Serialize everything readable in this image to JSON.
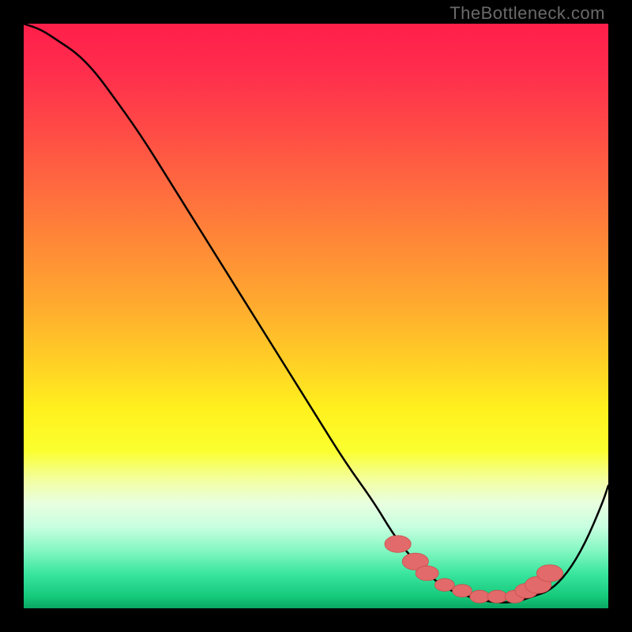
{
  "watermark": "TheBottleneck.com",
  "colors": {
    "curve": "#000000",
    "marker_fill": "#e36a6a",
    "marker_stroke": "#c94f4f",
    "gradient_top": "#ff1f4a",
    "gradient_bottom": "#0aa661"
  },
  "chart_data": {
    "type": "line",
    "title": "",
    "xlabel": "",
    "ylabel": "",
    "xlim": [
      0,
      100
    ],
    "ylim": [
      0,
      100
    ],
    "curve": {
      "x": [
        0,
        3,
        6,
        9,
        12,
        15,
        20,
        25,
        30,
        35,
        40,
        45,
        50,
        55,
        60,
        63,
        66,
        70,
        73,
        76,
        80,
        84,
        87,
        90,
        93,
        96,
        99,
        100
      ],
      "y": [
        100,
        99,
        97,
        95,
        92,
        88,
        81,
        73,
        65,
        57,
        49,
        41,
        33,
        25,
        18,
        13,
        9,
        5,
        3,
        2,
        1,
        1,
        2,
        3,
        6,
        11,
        18,
        21
      ]
    },
    "markers": [
      {
        "x": 64,
        "y": 11,
        "r": 1.6
      },
      {
        "x": 67,
        "y": 8,
        "r": 1.6
      },
      {
        "x": 69,
        "y": 6,
        "r": 1.4
      },
      {
        "x": 72,
        "y": 4,
        "r": 1.2
      },
      {
        "x": 75,
        "y": 3,
        "r": 1.2
      },
      {
        "x": 78,
        "y": 2,
        "r": 1.2
      },
      {
        "x": 81,
        "y": 2,
        "r": 1.2
      },
      {
        "x": 84,
        "y": 2,
        "r": 1.2
      },
      {
        "x": 86,
        "y": 3,
        "r": 1.4
      },
      {
        "x": 88,
        "y": 4,
        "r": 1.6
      },
      {
        "x": 90,
        "y": 6,
        "r": 1.6
      }
    ]
  }
}
